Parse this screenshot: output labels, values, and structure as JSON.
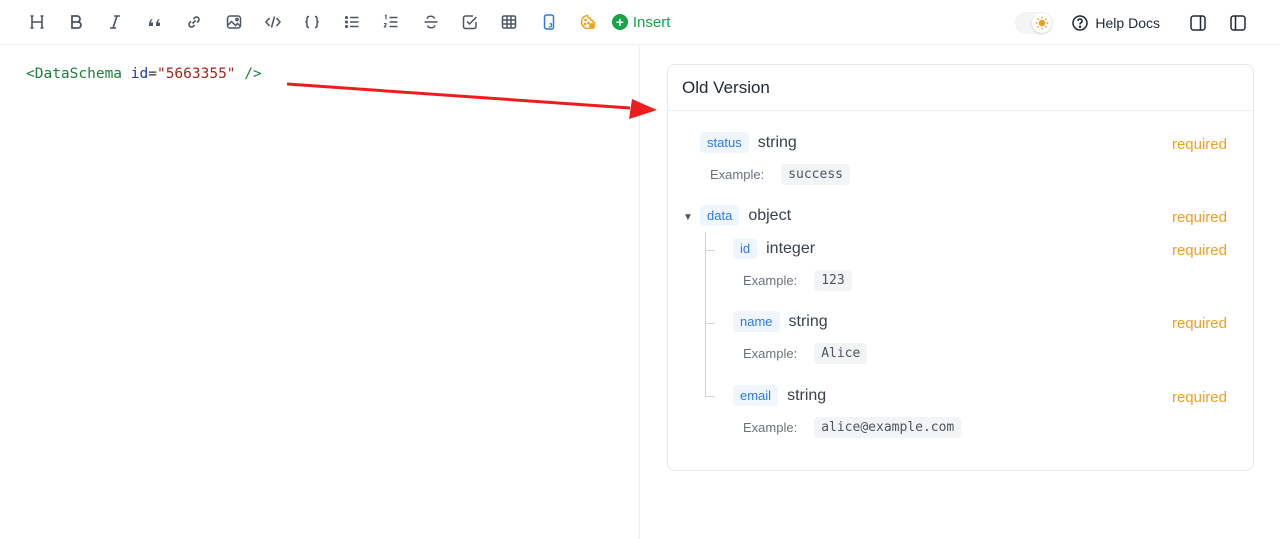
{
  "toolbar": {
    "tools": [
      {
        "name": "heading-icon"
      },
      {
        "name": "bold-icon"
      },
      {
        "name": "italic-icon"
      },
      {
        "name": "quote-icon"
      },
      {
        "name": "link-icon"
      },
      {
        "name": "image-icon"
      },
      {
        "name": "code-icon"
      },
      {
        "name": "code-block-icon"
      },
      {
        "name": "bullet-list-icon"
      },
      {
        "name": "ordered-list-icon"
      },
      {
        "name": "strikethrough-icon"
      },
      {
        "name": "task-list-icon"
      },
      {
        "name": "table-icon"
      },
      {
        "name": "mobile-icon"
      },
      {
        "name": "cookie-icon"
      }
    ],
    "insert_label": "Insert",
    "help_label": "Help Docs",
    "accent_color": "#16a34a"
  },
  "editor": {
    "code": {
      "open": "<DataSchema",
      "attr": "id",
      "eq": "=",
      "value": "\"5663355\"",
      "close": "/>"
    }
  },
  "schema_card": {
    "title": "Old Version",
    "example_label": "Example:",
    "required_label": "required",
    "fields": [
      {
        "name": "status",
        "type": "string",
        "required": "required",
        "example": "success"
      },
      {
        "name": "data",
        "type": "object",
        "required": "required",
        "children": [
          {
            "name": "id",
            "type": "integer",
            "required": "required",
            "example": "123"
          },
          {
            "name": "name",
            "type": "string",
            "required": "required",
            "example": "Alice"
          },
          {
            "name": "email",
            "type": "string",
            "required": "required",
            "example": "alice@example.com"
          }
        ]
      }
    ]
  }
}
